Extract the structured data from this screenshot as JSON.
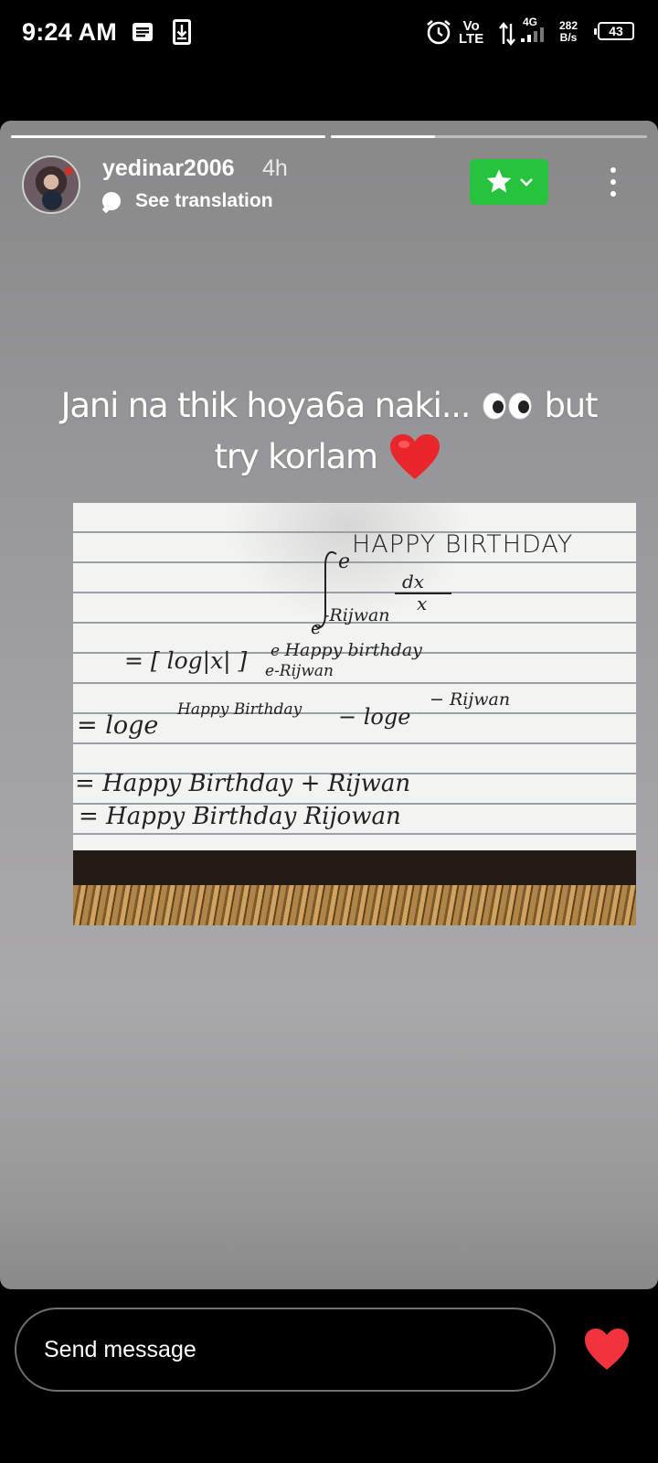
{
  "status_bar": {
    "time": "9:24 AM",
    "network_vo": "Vo",
    "network_lte": "LTE",
    "network_gen": "4G",
    "speed_value": "282",
    "speed_unit": "B/s",
    "battery": "43",
    "icons": [
      "message-icon",
      "download-icon",
      "alarm-icon",
      "data-arrows-icon",
      "signal-icon",
      "battery-icon"
    ]
  },
  "story": {
    "progress_segments": [
      1.0,
      0.33
    ],
    "username": "yedinar2006",
    "time_ago": "4h",
    "translate_label": "See translation",
    "caption_line1_a": "Jani na thik hoya6a naki...",
    "caption_line1_b": "but",
    "caption_line2": "try korlam",
    "caption_emoji": [
      "eyes-emoji",
      "heart-emoji"
    ],
    "favorite_color": "#27c33f"
  },
  "photo_text": {
    "title": "HAPPY  BIRTHDAY",
    "upper_limit": "e",
    "integrand_num": "dx",
    "integrand_den": "x",
    "lower_limit": "e",
    "lower_limit_exp": "-Rijwan",
    "line2_a": "= [ log|x| ]",
    "line2_sup": "e",
    "line2_sup_b": "Happy birthday",
    "line2_sub": "e",
    "line2_sub_b": "-Rijwan",
    "line3_a": "=  loge",
    "line3_sup": "Happy Birthday",
    "line3_b": "−  loge",
    "line3_sup2": "− Rijwan",
    "line4": "= Happy  Birthday  +  Rijwan",
    "line5": "= Happy  Birthday  Rijowan"
  },
  "bottom": {
    "message_placeholder": "Send message",
    "heart_color": "#f0333d"
  }
}
